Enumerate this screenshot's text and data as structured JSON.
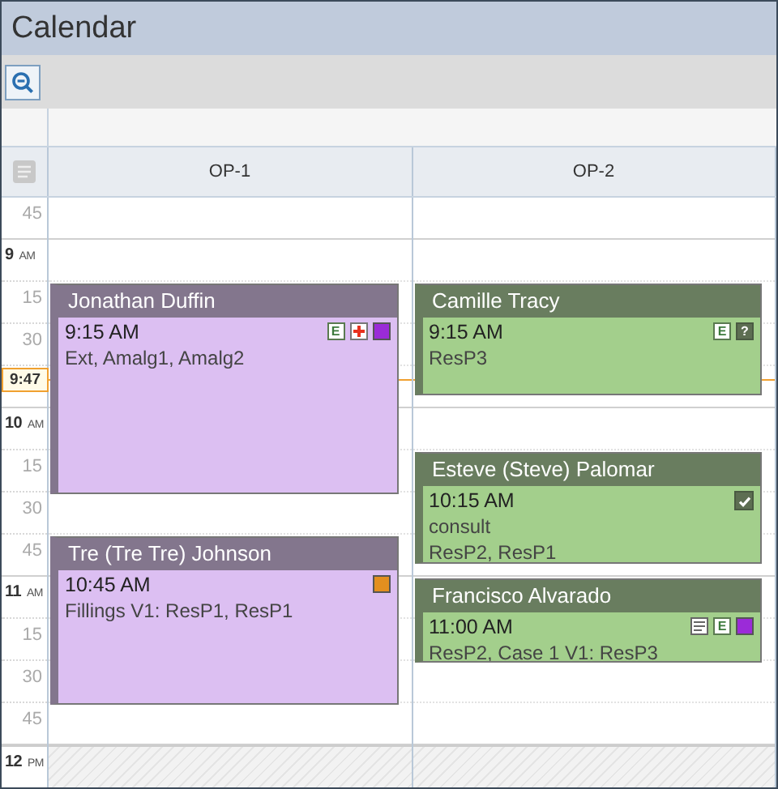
{
  "window": {
    "title": "Calendar"
  },
  "columns": [
    {
      "label": "OP-1",
      "appointments": [
        {
          "name": "Jonathan Duffin",
          "time": "9:15 AM",
          "lines": [
            "Ext, Amalg1, Amalg2"
          ],
          "color": "#dcbff2",
          "icons": [
            {
              "kind": "badge",
              "text": "E"
            },
            {
              "kind": "cross"
            },
            {
              "kind": "swatch",
              "color": "#9b2bd8"
            }
          ]
        },
        {
          "name": "Tre (Tre Tre) Johnson",
          "time": "10:45 AM",
          "lines": [
            "Fillings V1: ResP1, ResP1"
          ],
          "color": "#dcbff2",
          "icons": [
            {
              "kind": "swatch",
              "color": "#e38f1f"
            }
          ]
        }
      ]
    },
    {
      "label": "OP-2",
      "appointments": [
        {
          "name": "Camille Tracy",
          "time": "9:15 AM",
          "lines": [
            "ResP3"
          ],
          "color": "#a3cf8c",
          "icons": [
            {
              "kind": "badge",
              "text": "E"
            },
            {
              "kind": "dark-badge",
              "text": "?"
            }
          ]
        },
        {
          "name": "Esteve (Steve) Palomar",
          "time": "10:15 AM",
          "lines": [
            "consult",
            "ResP2, ResP1"
          ],
          "color": "#a3cf8c",
          "icons": [
            {
              "kind": "check"
            }
          ]
        },
        {
          "name": "Francisco Alvarado",
          "time": "11:00 AM",
          "lines": [
            "ResP2, Case 1 V1: ResP3"
          ],
          "color": "#a3cf8c",
          "icons": [
            {
              "kind": "note"
            },
            {
              "kind": "badge",
              "text": "E"
            },
            {
              "kind": "swatch",
              "color": "#9b2bd8"
            }
          ]
        }
      ]
    }
  ],
  "time_slots": [
    {
      "kind": "minute",
      "label": "45"
    },
    {
      "kind": "hour",
      "label": "9",
      "period": "AM"
    },
    {
      "kind": "minute",
      "label": "15"
    },
    {
      "kind": "minute",
      "label": "30"
    },
    {
      "kind": "blank"
    },
    {
      "kind": "hour",
      "label": "10",
      "period": "AM"
    },
    {
      "kind": "minute",
      "label": "15"
    },
    {
      "kind": "minute",
      "label": "30"
    },
    {
      "kind": "minute",
      "label": "45"
    },
    {
      "kind": "hour",
      "label": "11",
      "period": "AM"
    },
    {
      "kind": "minute",
      "label": "15"
    },
    {
      "kind": "minute",
      "label": "30"
    },
    {
      "kind": "minute",
      "label": "45"
    },
    {
      "kind": "hour",
      "label": "12",
      "period": "PM"
    }
  ],
  "current_time": {
    "label": "9:47"
  }
}
